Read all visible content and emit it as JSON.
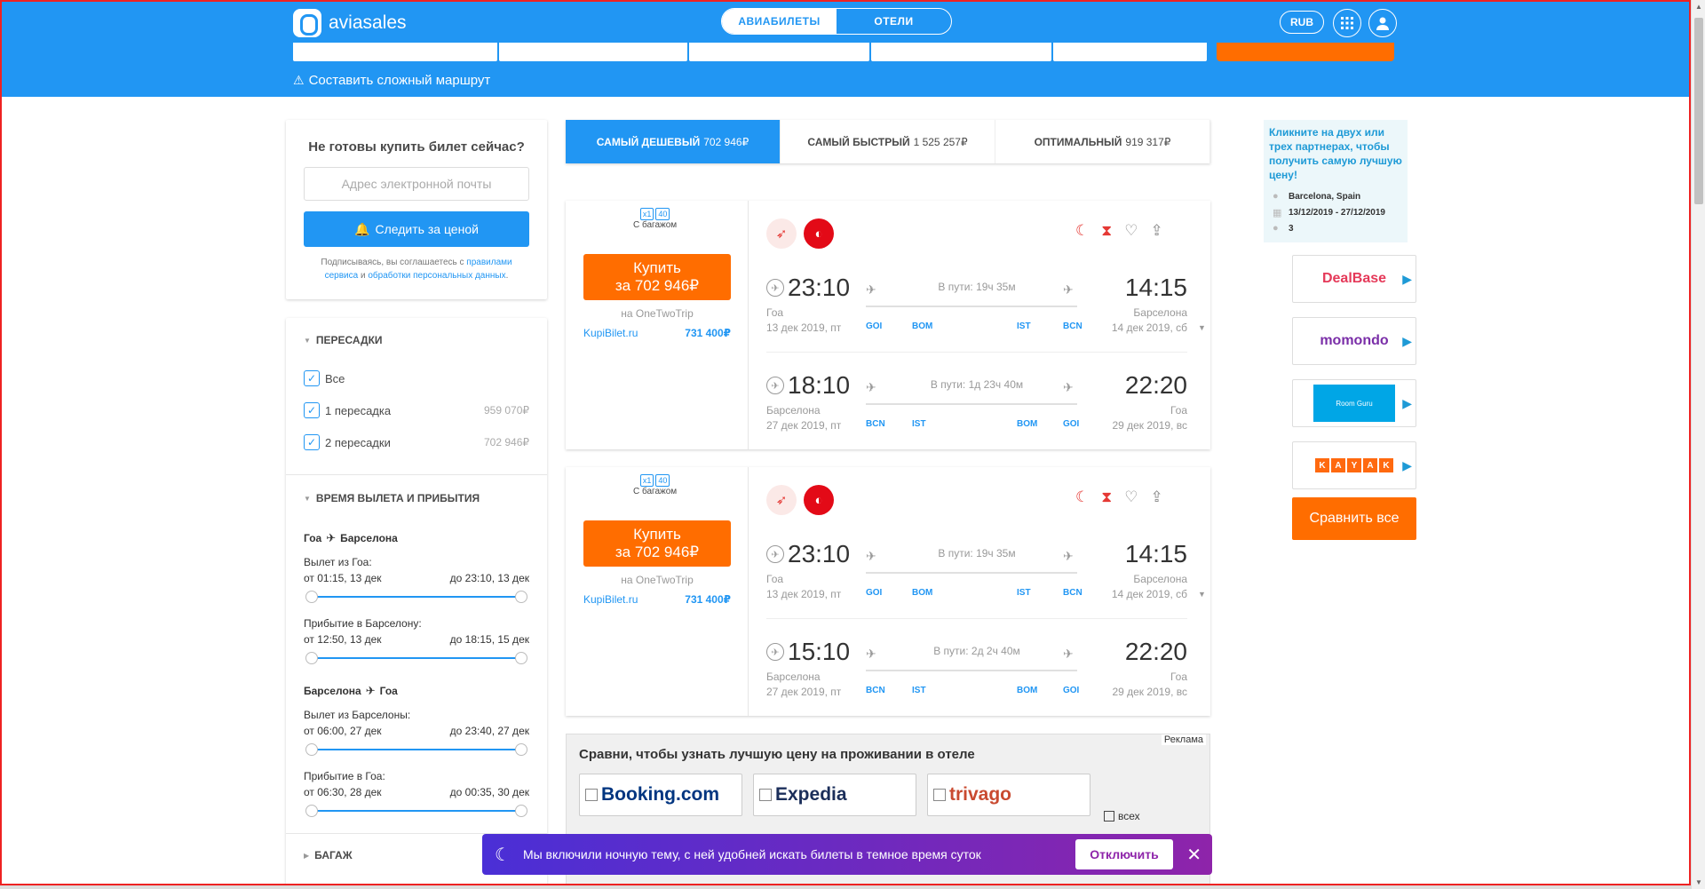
{
  "header": {
    "logo_text": "aviasales",
    "tabs": [
      "АВИАБИЛЕТЫ",
      "ОТЕЛИ"
    ],
    "currency": "RUB",
    "complex_route": "Составить сложный маршрут"
  },
  "subscribe": {
    "title": "Не готовы купить билет сейчас?",
    "email_placeholder": "Адрес электронной почты",
    "button": "Следить за ценой",
    "legal_1": "Подписываясь, вы соглашаетесь с ",
    "legal_link1": "правилами сервиса",
    "legal_2": " и ",
    "legal_link2": "обработки персональных данных",
    "legal_3": "."
  },
  "filters": {
    "stops_title": "ПЕРЕСАДКИ",
    "stops": [
      {
        "label": "Все",
        "price": "",
        "checked": true
      },
      {
        "label": "1 пересадка",
        "price": "959 070₽",
        "checked": true
      },
      {
        "label": "2 пересадки",
        "price": "702 946₽",
        "checked": true
      }
    ],
    "times_title": "ВРЕМЯ ВЫЛЕТА И ПРИБЫТИЯ",
    "route1": {
      "from": "Гоа",
      "to": "Барселона"
    },
    "route1_dep_label": "Вылет из Гоа:",
    "route1_dep_from": "от 01:15, 13 дек",
    "route1_dep_to": "до 23:10, 13 дек",
    "route1_arr_label": "Прибытие в Барселону:",
    "route1_arr_from": "от 12:50, 13 дек",
    "route1_arr_to": "до 18:15, 15 дек",
    "route2": {
      "from": "Барселона",
      "to": "Гоа"
    },
    "route2_dep_label": "Вылет из Барселоны:",
    "route2_dep_from": "от 06:00, 27 дек",
    "route2_dep_to": "до 23:40, 27 дек",
    "route2_arr_label": "Прибытие в Гоа:",
    "route2_arr_from": "от 06:30, 28 дек",
    "route2_arr_to": "до 00:35, 30 дек",
    "baggage_title": "БАГАЖ"
  },
  "sort_tabs": [
    {
      "label": "САМЫЙ ДЕШЕВЫЙ",
      "price": "702 946₽",
      "active": true
    },
    {
      "label": "САМЫЙ БЫСТРЫЙ",
      "price": "1 525 257₽",
      "active": false
    },
    {
      "label": "ОПТИМАЛЬНЫЙ",
      "price": "919 317₽",
      "active": false
    }
  ],
  "tickets": [
    {
      "baggage": "С багажом",
      "bag_x": "x1",
      "bag_kg": "40",
      "buy_line1": "Купить",
      "buy_line2": "за 702 946₽",
      "agent": "на OneTwoTrip",
      "alt_agent": "KupiBilet.ru",
      "alt_price": "731 400₽",
      "segments": [
        {
          "dep_time": "23:10",
          "arr_time": "14:15",
          "duration": "В пути: 19ч 35м",
          "dep_city": "Гоа",
          "arr_city": "Барселона",
          "dep_date": "13 дек 2019, пт",
          "arr_date": "14 дек 2019, сб",
          "codes": [
            "GOI",
            "BOM",
            "IST",
            "BCN"
          ]
        },
        {
          "dep_time": "18:10",
          "arr_time": "22:20",
          "duration": "В пути: 1д 23ч 40м",
          "dep_city": "Барселона",
          "arr_city": "Гоа",
          "dep_date": "27 дек 2019, пт",
          "arr_date": "29 дек 2019, вс",
          "codes": [
            "BCN",
            "IST",
            "BOM",
            "GOI"
          ]
        }
      ]
    },
    {
      "baggage": "С багажом",
      "bag_x": "x1",
      "bag_kg": "40",
      "buy_line1": "Купить",
      "buy_line2": "за 702 946₽",
      "agent": "на OneTwoTrip",
      "alt_agent": "KupiBilet.ru",
      "alt_price": "731 400₽",
      "segments": [
        {
          "dep_time": "23:10",
          "arr_time": "14:15",
          "duration": "В пути: 19ч 35м",
          "dep_city": "Гоа",
          "arr_city": "Барселона",
          "dep_date": "13 дек 2019, пт",
          "arr_date": "14 дек 2019, сб",
          "codes": [
            "GOI",
            "BOM",
            "IST",
            "BCN"
          ]
        },
        {
          "dep_time": "15:10",
          "arr_time": "22:20",
          "duration": "В пути: 2д 2ч 40м",
          "dep_city": "Барселона",
          "arr_city": "Гоа",
          "dep_date": "27 дек 2019, пт",
          "arr_date": "29 дек 2019, вс",
          "codes": [
            "BCN",
            "IST",
            "BOM",
            "GOI"
          ]
        }
      ]
    }
  ],
  "ad": {
    "label": "Реклама",
    "title": "Сравни, чтобы узнать лучшую цену на проживании в отеле",
    "providers": [
      "Booking.com",
      "Expedia",
      "trivago"
    ],
    "all_label": "всех"
  },
  "toast": {
    "text": "Мы включили ночную тему, с ней удобней искать билеты в темное время суток",
    "button": "Отключить"
  },
  "promo": {
    "headline": "Кликните на двух или трех партнерах, чтобы получить самую лучшую цену!",
    "city": "Barcelona, Spain",
    "dates": "13/12/2019 - 27/12/2019",
    "guests": "3",
    "partners": [
      "DealBase",
      "momondo",
      "Room Guru",
      "KAYAK"
    ],
    "compare_button": "Сравнить все"
  },
  "colors": {
    "brand_blue": "#2196f3",
    "buy_orange": "#ff6d00",
    "toast_purple": "#8e24aa"
  }
}
